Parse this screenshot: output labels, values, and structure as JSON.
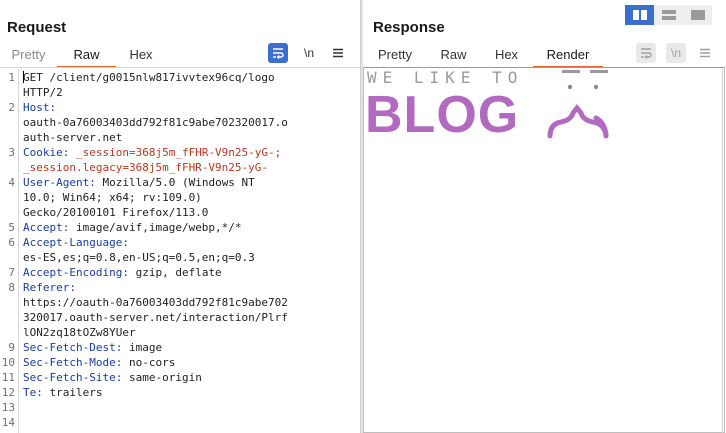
{
  "request": {
    "title": "Request",
    "tabs": [
      {
        "label": "Pretty",
        "state": "dim"
      },
      {
        "label": "Raw",
        "state": "active"
      },
      {
        "label": "Hex",
        "state": "normal"
      }
    ],
    "tools": {
      "wrap_icon": "word-wrap-icon",
      "newline_label": "\\n",
      "menu_icon": "hamburger-menu-icon"
    },
    "lines": [
      {
        "n": "1",
        "key": "",
        "value": "GET /client/g0015nlw817ivvtex96cq/logo"
      },
      {
        "n": "",
        "key": "",
        "value": "HTTP/2"
      },
      {
        "n": "2",
        "key": "Host:",
        "value": ""
      },
      {
        "n": "",
        "key": "",
        "value": "oauth-0a76003403dd792f81c9abe702320017.o"
      },
      {
        "n": "",
        "key": "",
        "value": "auth-server.net"
      },
      {
        "n": "3",
        "key": "Cookie:",
        "value": " _session=368j5m_fFHR-V9n25-yG-;"
      },
      {
        "n": "",
        "key": "",
        "value": "_session.legacy=368j5m_fFHR-V9n25-yG-"
      },
      {
        "n": "4",
        "key": "User-Agent:",
        "value": " Mozilla/5.0 (Windows NT"
      },
      {
        "n": "",
        "key": "",
        "value": "10.0; Win64; x64; rv:109.0)"
      },
      {
        "n": "",
        "key": "",
        "value": "Gecko/20100101 Firefox/113.0"
      },
      {
        "n": "5",
        "key": "Accept:",
        "value": " image/avif,image/webp,*/*"
      },
      {
        "n": "6",
        "key": "Accept-Language:",
        "value": ""
      },
      {
        "n": "",
        "key": "",
        "value": "es-ES,es;q=0.8,en-US;q=0.5,en;q=0.3"
      },
      {
        "n": "7",
        "key": "Accept-Encoding:",
        "value": " gzip, deflate"
      },
      {
        "n": "8",
        "key": "Referer:",
        "value": ""
      },
      {
        "n": "",
        "key": "",
        "value": "https://oauth-0a76003403dd792f81c9abe702"
      },
      {
        "n": "",
        "key": "",
        "value": "320017.oauth-server.net/interaction/Plrf"
      },
      {
        "n": "",
        "key": "",
        "value": "lON2zq18tOZw8YUer"
      },
      {
        "n": "9",
        "key": "Sec-Fetch-Dest:",
        "value": " image"
      },
      {
        "n": "10",
        "key": "Sec-Fetch-Mode:",
        "value": " no-cors"
      },
      {
        "n": "11",
        "key": "Sec-Fetch-Site:",
        "value": " same-origin"
      },
      {
        "n": "12",
        "key": "Te:",
        "value": " trailers"
      },
      {
        "n": "13",
        "key": "",
        "value": ""
      },
      {
        "n": "14",
        "key": "",
        "value": ""
      }
    ]
  },
  "response": {
    "title": "Response",
    "tabs": [
      {
        "label": "Pretty",
        "state": "normal"
      },
      {
        "label": "Raw",
        "state": "normal"
      },
      {
        "label": "Hex",
        "state": "normal"
      },
      {
        "label": "Render",
        "state": "active"
      }
    ],
    "tools": {
      "wrap_icon": "word-wrap-icon",
      "newline_label": "\\n",
      "menu_icon": "hamburger-menu-icon"
    },
    "render": {
      "small_text": "WE LIKE TO",
      "big_text": "BLOG"
    }
  },
  "layout_switch": {
    "options": [
      "side-by-side-layout-icon",
      "stacked-layout-icon",
      "single-pane-layout-icon"
    ],
    "selected": 0
  },
  "colors": {
    "accent_blue": "#3b6fcf",
    "tab_underline": "#e8642c",
    "header_key": "#1a3d9e",
    "cookie_value": "#b33a1e",
    "blog_purple": "#b26ac0"
  }
}
